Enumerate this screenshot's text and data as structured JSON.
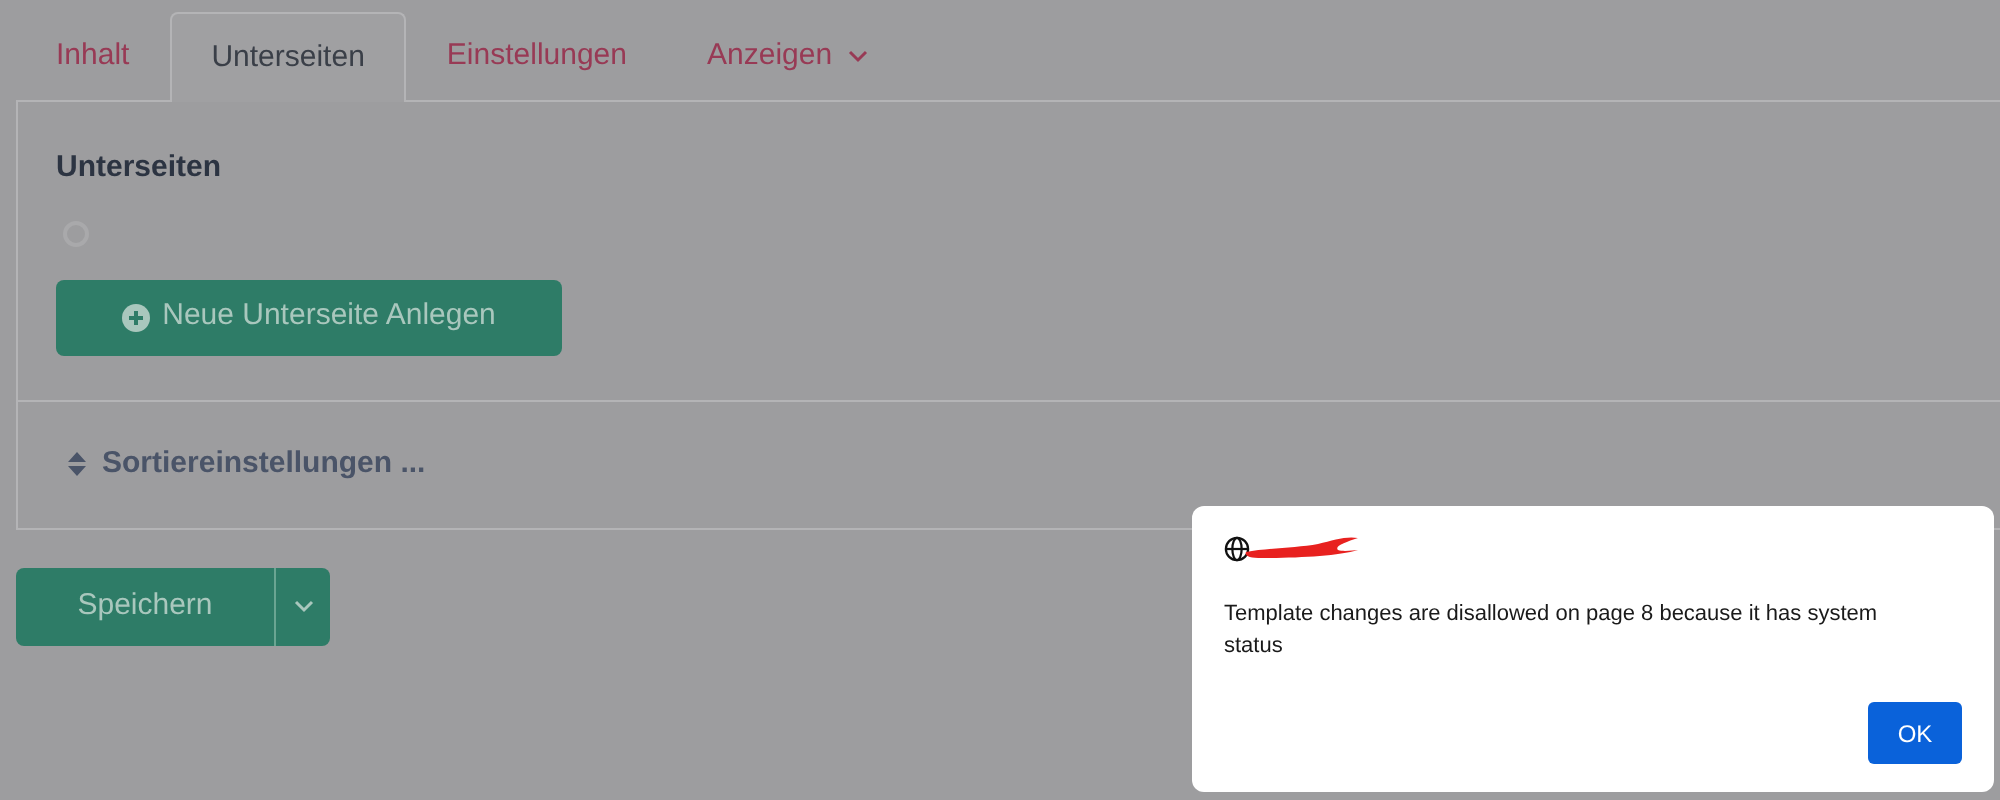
{
  "tabs": [
    {
      "label": "Inhalt",
      "selected": false,
      "kind": "tab"
    },
    {
      "label": "Unterseiten",
      "selected": true,
      "kind": "tab"
    },
    {
      "label": "Einstellungen",
      "selected": false,
      "kind": "tab"
    },
    {
      "label": "Anzeigen",
      "selected": false,
      "kind": "dropdown"
    }
  ],
  "panel": {
    "heading": "Unterseiten",
    "add_button": "Neue Unterseite Anlegen",
    "sort_toggle": "Sortiereinstellungen ..."
  },
  "save_button": "Speichern",
  "dialog": {
    "message": "Template changes are disallowed on page 8 because it has system status",
    "ok_button": "OK"
  }
}
